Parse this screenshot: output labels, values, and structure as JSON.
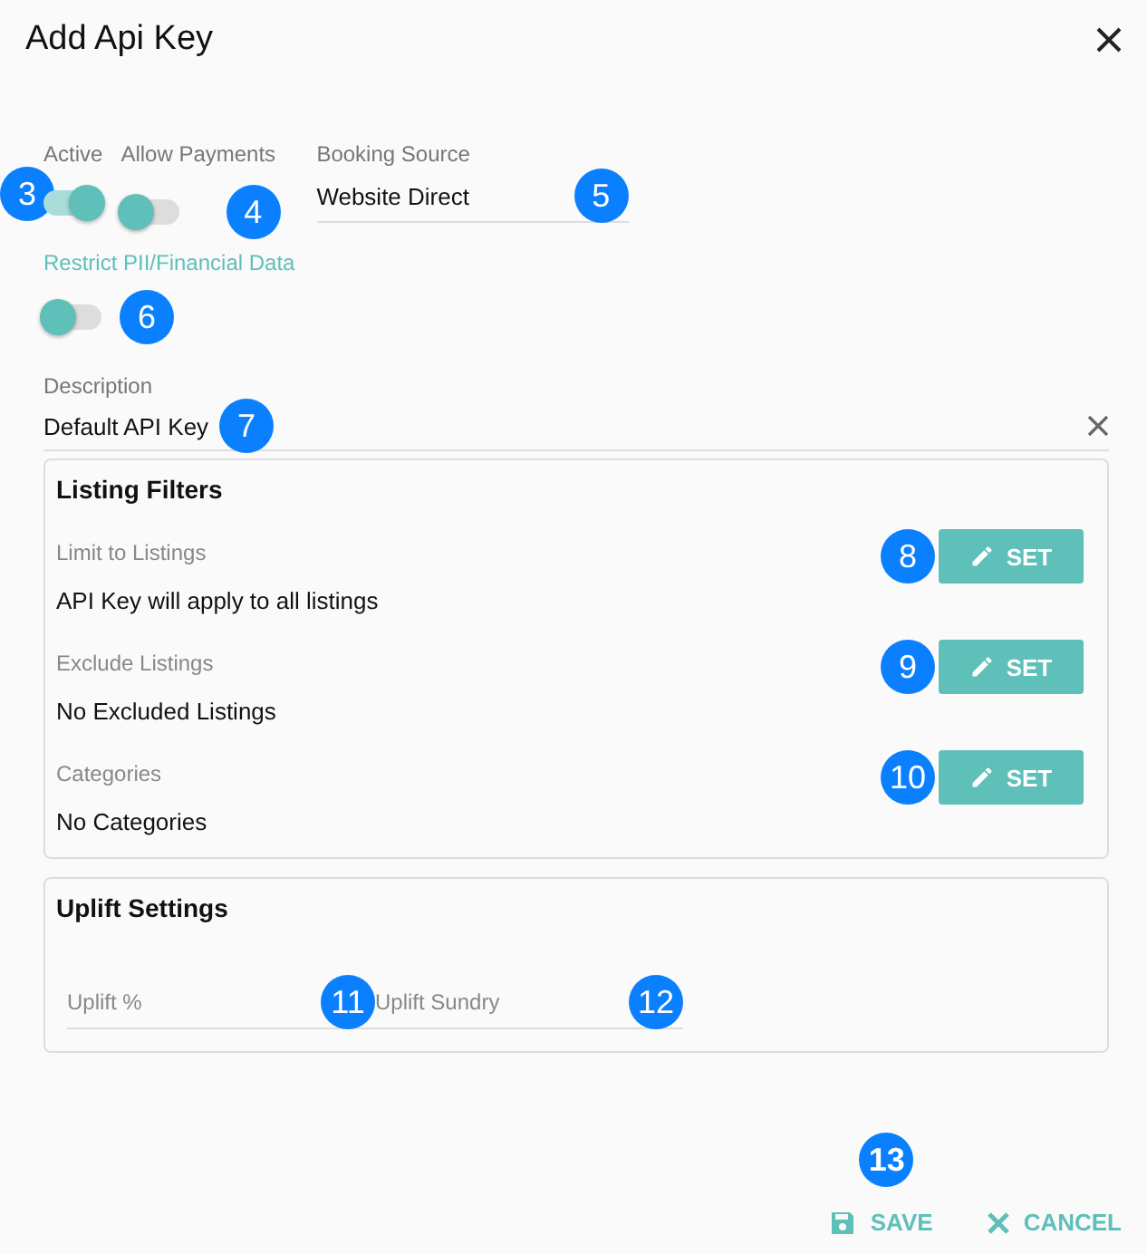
{
  "dialog": {
    "title": "Add Api Key"
  },
  "toggles": [
    {
      "label": "Active",
      "on": true,
      "marker": "3"
    },
    {
      "label": "Allow Payments",
      "on": false,
      "marker": "4"
    }
  ],
  "booking_source": {
    "label": "Booking Source",
    "value": "Website Direct",
    "marker": "5"
  },
  "restrict_toggle": {
    "label": "Restrict PII/Financial Data",
    "on": false,
    "marker": "6"
  },
  "description": {
    "label": "Description",
    "value": "Default API Key",
    "marker": "7"
  },
  "listing_filters": {
    "title": "Listing Filters",
    "rows": [
      {
        "label": "Limit to Listings",
        "value": "API Key will apply to all listings",
        "button": "SET",
        "marker": "8"
      },
      {
        "label": "Exclude Listings",
        "value": "No Excluded Listings",
        "button": "SET",
        "marker": "9"
      },
      {
        "label": "Categories",
        "value": "No Categories",
        "button": "SET",
        "marker": "10"
      }
    ]
  },
  "uplift_settings": {
    "title": "Uplift Settings",
    "fields": [
      {
        "placeholder": "Uplift %",
        "marker": "11"
      },
      {
        "placeholder": "Uplift Sundry",
        "marker": "12"
      }
    ]
  },
  "footer": {
    "save": "SAVE",
    "save_marker": "13",
    "cancel": "CANCEL"
  }
}
